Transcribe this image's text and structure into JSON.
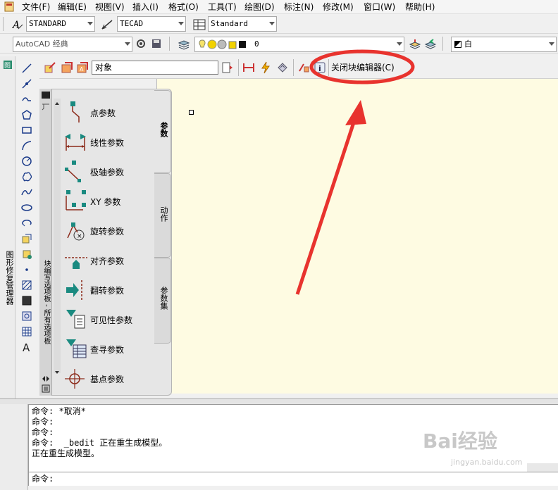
{
  "menu": {
    "items": [
      "文件(F)",
      "编辑(E)",
      "视图(V)",
      "插入(I)",
      "格式(O)",
      "工具(T)",
      "绘图(D)",
      "标注(N)",
      "修改(M)",
      "窗口(W)",
      "帮助(H)"
    ]
  },
  "styles_toolbar": {
    "text_style": "STANDARD",
    "dim_style": "TECAD",
    "table_style": "Standard"
  },
  "workspace_toolbar": {
    "workspace": "AutoCAD 经典",
    "layer": "0",
    "color": "白"
  },
  "block_editor_toolbar": {
    "block_name": "对象",
    "close_label": "关闭块编辑器(C)"
  },
  "left_panel": {
    "sheet_manager_label": "图形修复管理器"
  },
  "palette": {
    "side_title": "块编写选项板 - 所有选项板",
    "items": [
      {
        "label": "点参数",
        "icon": "point-parameter-icon"
      },
      {
        "label": "线性参数",
        "icon": "linear-parameter-icon"
      },
      {
        "label": "极轴参数",
        "icon": "polar-parameter-icon"
      },
      {
        "label": "XY 参数",
        "icon": "xy-parameter-icon"
      },
      {
        "label": "旋转参数",
        "icon": "rotation-parameter-icon"
      },
      {
        "label": "对齐参数",
        "icon": "alignment-parameter-icon"
      },
      {
        "label": "翻转参数",
        "icon": "flip-parameter-icon"
      },
      {
        "label": "可见性参数",
        "icon": "visibility-parameter-icon"
      },
      {
        "label": "查寻参数",
        "icon": "lookup-parameter-icon"
      },
      {
        "label": "基点参数",
        "icon": "basepoint-parameter-icon"
      }
    ],
    "tabs": [
      "参数",
      "动作",
      "参数集"
    ]
  },
  "command": {
    "history": [
      "命令: *取消*",
      "命令:",
      "命令:",
      "命令:  _bedit 正在重生成模型。",
      "正在重生成模型。"
    ],
    "prompt": "命令:"
  },
  "watermark": {
    "brand": "Bai经验",
    "url": "jingyan.baidu.com"
  },
  "colors": {
    "canvas": "#fefbe2",
    "annotation": "#e8332e",
    "palette_teal": "#1a8a80"
  }
}
